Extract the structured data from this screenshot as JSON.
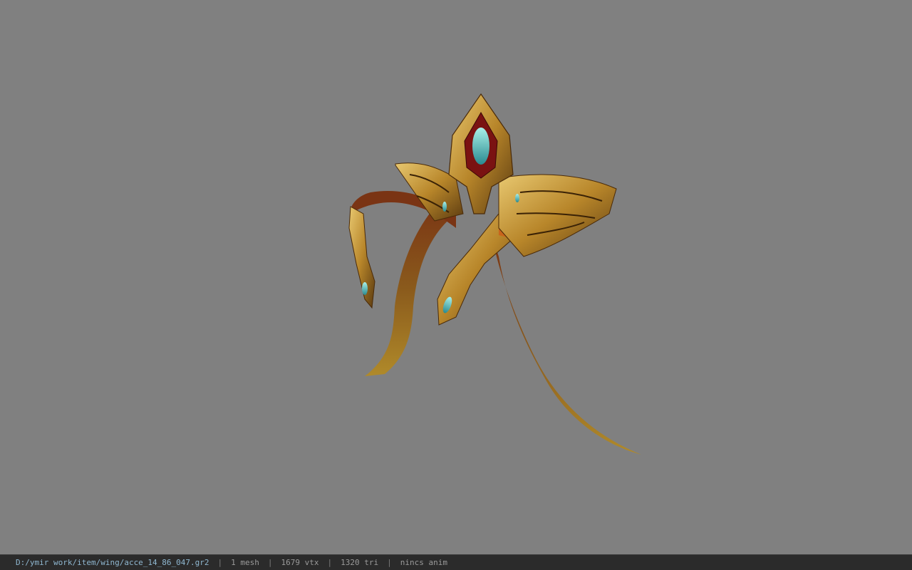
{
  "viewport": {
    "background_color": "#808080",
    "model": {
      "icon": "wing-accessory-model",
      "colors": {
        "gold": "#c89a3a",
        "gold_dark": "#6b4a14",
        "ribbon": "#8a4a1c",
        "ribbon_end": "#a07a22",
        "gem": "#5fd0c8",
        "gem_red": "#9a1a1a"
      }
    }
  },
  "statusbar": {
    "file_path": "D:/ymir work/item/wing/acce_14_86_047.gr2",
    "mesh_count": "1 mesh",
    "vertex_count": "1679 vtx",
    "triangle_count": "1320 tri",
    "animation": "nincs anim",
    "separator": "|",
    "background_color": "#2b2b2b",
    "path_color": "#8fb7d0"
  }
}
